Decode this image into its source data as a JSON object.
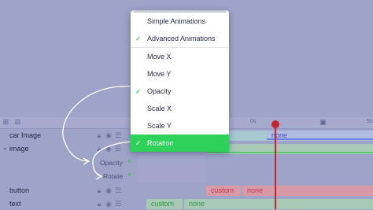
{
  "menu": {
    "items": [
      {
        "label": "Simple Animations",
        "checked": false
      },
      {
        "label": "Advanced Animations",
        "checked": true
      },
      {
        "label": "Move X",
        "checked": false
      },
      {
        "label": "Move Y",
        "checked": false
      },
      {
        "label": "Opacity",
        "checked": true
      },
      {
        "label": "Scale X",
        "checked": false
      },
      {
        "label": "Scale Y",
        "checked": false
      },
      {
        "label": "Rotation",
        "checked": true
      }
    ],
    "check_glyph": "✓"
  },
  "timeline": {
    "ticks": [
      "0s",
      "5s"
    ],
    "layers": [
      {
        "label": "car Image",
        "tracks": [
          "none"
        ]
      },
      {
        "label": "image",
        "props": [
          "Opacity",
          "Rotate"
        ]
      },
      {
        "label": "button",
        "tracks": [
          "custom",
          "none"
        ]
      },
      {
        "label": "text",
        "tracks": [
          "custom",
          "none"
        ]
      }
    ],
    "prop_add_glyph": "+"
  },
  "icons": {
    "lock": "lock-icon",
    "eye": "eye-icon",
    "track": "track-icon",
    "chevron": "chevron-down-icon"
  },
  "colors": {
    "accent_green": "#2ED15A",
    "track_red": "#E87880",
    "track_green": "#52C46A",
    "track_blue": "#7E8FE0",
    "playhead": "#C6232F"
  }
}
